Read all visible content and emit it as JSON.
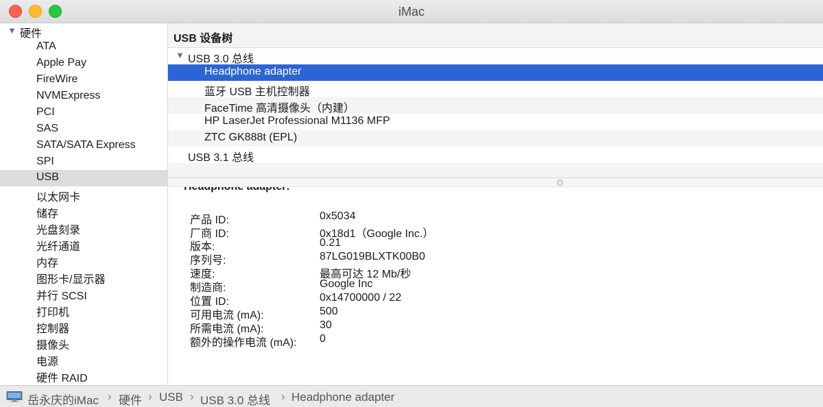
{
  "window": {
    "title": "iMac"
  },
  "sidebar": {
    "group_label": "硬件",
    "items": [
      {
        "label": "ATA"
      },
      {
        "label": "Apple Pay"
      },
      {
        "label": "FireWire"
      },
      {
        "label": "NVMExpress"
      },
      {
        "label": "PCI"
      },
      {
        "label": "SAS"
      },
      {
        "label": "SATA/SATA Express"
      },
      {
        "label": "SPI"
      },
      {
        "label": "USB",
        "selected": true
      },
      {
        "label": "以太网卡"
      },
      {
        "label": "储存"
      },
      {
        "label": "光盘刻录"
      },
      {
        "label": "光纤通道"
      },
      {
        "label": "内存"
      },
      {
        "label": "图形卡/显示器"
      },
      {
        "label": "并行 SCSI"
      },
      {
        "label": "打印机"
      },
      {
        "label": "控制器"
      },
      {
        "label": "摄像头"
      },
      {
        "label": "电源"
      },
      {
        "label": "硬件 RAID"
      }
    ]
  },
  "main": {
    "header": "USB 设备树",
    "tree": [
      {
        "label": "USB 3.0 总线",
        "expanded": true
      },
      {
        "label": "Headphone adapter",
        "selected": true
      },
      {
        "label": "蓝牙 USB 主机控制器"
      },
      {
        "label": "FaceTime 高清摄像头（内建）"
      },
      {
        "label": "HP LaserJet Professional M1136 MFP"
      },
      {
        "label": "ZTC GK888t (EPL)"
      },
      {
        "label": "USB 3.1 总线"
      }
    ],
    "detail": {
      "title": "Headphone adapter:",
      "properties": [
        {
          "label": "产品 ID:",
          "value": "0x5034"
        },
        {
          "label": "厂商 ID:",
          "value": "0x18d1（Google Inc.）"
        },
        {
          "label": "版本:",
          "value": "0.21"
        },
        {
          "label": "序列号:",
          "value": "87LG019BLXTK00B0"
        },
        {
          "label": "速度:",
          "value": "最高可达 12 Mb/秒"
        },
        {
          "label": "制造商:",
          "value": "Google Inc"
        },
        {
          "label": "位置 ID:",
          "value": "0x14700000 / 22"
        },
        {
          "label": "可用电流 (mA):",
          "value": "500"
        },
        {
          "label": "所需电流 (mA):",
          "value": "30"
        },
        {
          "label": "额外的操作电流 (mA):",
          "value": "0"
        }
      ]
    }
  },
  "pathbar": {
    "crumbs": [
      "岳永庆的iMac",
      "硬件",
      "USB",
      "USB 3.0 总线",
      "Headphone adapter"
    ]
  },
  "colors": {
    "selection_blue": "#2b64d3",
    "sidebar_selected": "#dcdcdc",
    "close": "#fe5f57",
    "minimize": "#febc2e",
    "maximize": "#28c840"
  }
}
